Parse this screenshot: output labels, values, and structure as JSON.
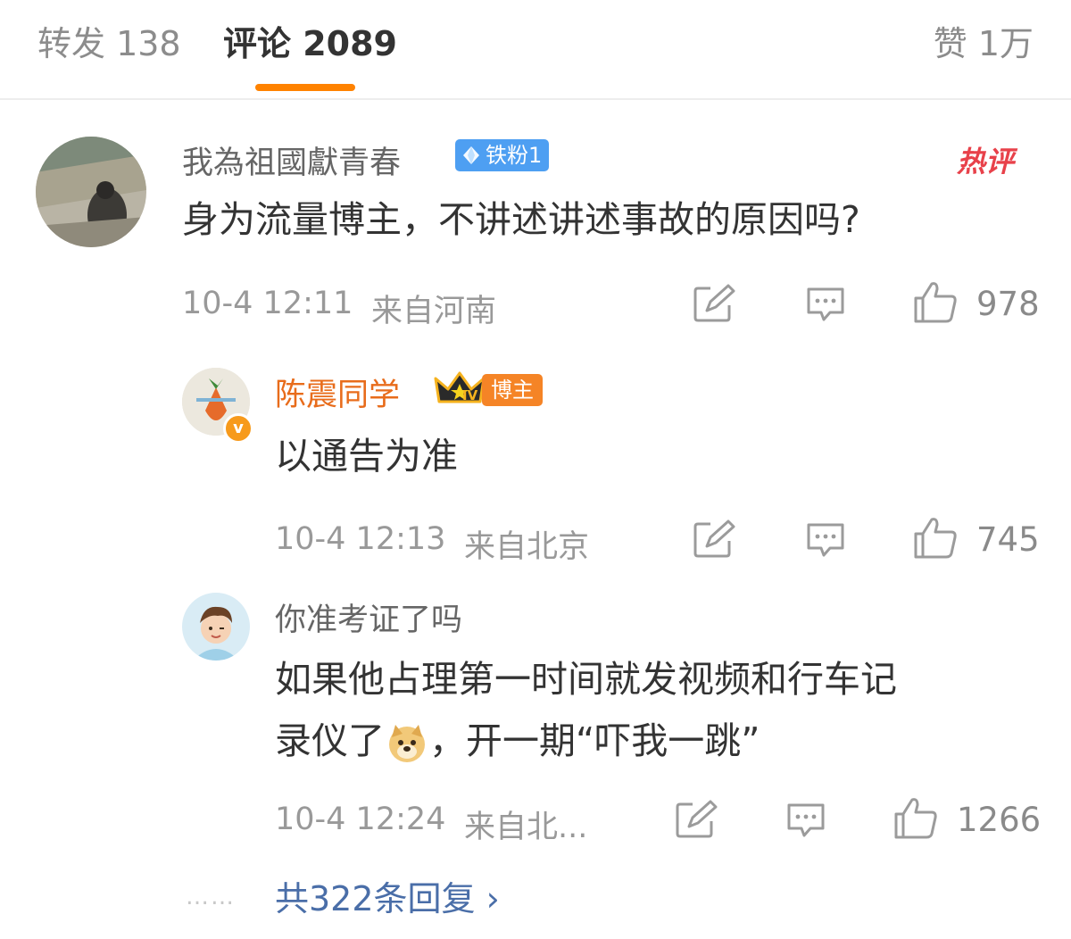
{
  "tabs": {
    "repost": "转发 138",
    "comments": "评论 2089",
    "likes": "赞 1万"
  },
  "comment": {
    "username": "我為祖國獻青春",
    "fan_badge": "铁粉1",
    "hot_tag": "热评",
    "text": "身为流量博主，不讲述讲述事故的原因吗?",
    "time": "10-4 12:11",
    "location": "来自河南",
    "like_count": "978"
  },
  "replies": [
    {
      "username": "陈震同学",
      "role_badge": "博主",
      "level_badge": "IV",
      "verified_badge": "v",
      "text": "以通告为准",
      "time": "10-4 12:13",
      "location": "来自北京",
      "like_count": "745"
    },
    {
      "username": "你准考证了吗",
      "text_line1": "如果他占理第一时间就发视频和行车记",
      "text_line2_before": "录仪了",
      "text_line2_after": "，开一期“吓我一跳”",
      "time": "10-4 12:24",
      "location": "来自北...",
      "like_count": "1266"
    }
  ],
  "more_replies": "共322条回复 ›",
  "colors": {
    "accent": "#ff8200",
    "blogger_name": "#e86c1b",
    "link": "#4a6ea8",
    "hot": "#e8414a",
    "fan_badge": "#4e9ff2"
  },
  "icons": [
    "repost-icon",
    "comment-icon",
    "like-icon",
    "diamond-icon",
    "crown-icon",
    "chevron-right-icon"
  ]
}
